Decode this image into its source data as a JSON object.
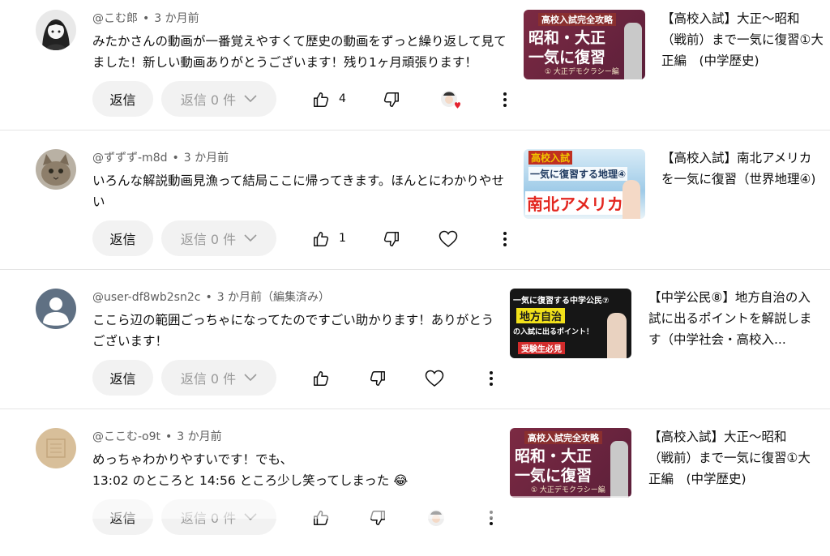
{
  "comments": [
    {
      "author": "@こむ郎",
      "time": "3 か月前",
      "text": "みたかさんの動画が一番覚えやすくて歴史の動画をずっと繰り返して見てました！新しい動画ありがとうございます！残り1ヶ月頑張ります！",
      "reply_label": "返信",
      "replies_label": "返信 0 件",
      "likes": "4",
      "video_title": "【高校入試】大正〜昭和（戦前）まで一気に復習①大正編　(中学歴史)",
      "thumb": {
        "top": "高校入試完全攻略",
        "main1": "昭和・大正",
        "main2": "一気に復習",
        "sub": "① 大正デモクラシー編"
      }
    },
    {
      "author": "@ずずず-m8d",
      "time": "3 か月前",
      "text": "いろんな解説動画見漁って結局ここに帰ってきます。ほんとにわかりやせい",
      "reply_label": "返信",
      "replies_label": "返信 0 件",
      "likes": "1",
      "video_title": "【高校入試】南北アメリカを一気に復習（世界地理④)",
      "thumb": {
        "top": "高校入試",
        "main1": "一気に復習する地理④",
        "main2": "南北アメリカ"
      }
    },
    {
      "author": "@user-df8wb2sn2c",
      "time": "3 か月前（編集済み）",
      "text": "ここら辺の範囲ごっちゃになってたのですごい助かります！ありがとうございます！",
      "reply_label": "返信",
      "replies_label": "返信 0 件",
      "likes": "",
      "video_title": "【中学公民⑧】地方自治の入試に出るポイントを解説します（中学社会・高校入...",
      "thumb": {
        "top": "一気に復習する中学公民⑦",
        "main1": "地方自治",
        "main2": "の入試に出るポイント！",
        "sub": "受験生必見"
      }
    },
    {
      "author": "@ここむ-o9t",
      "time": "3 か月前",
      "text_line1": "めっちゃわかりやすいです！でも、",
      "text_line2": "13:02 のところと 14:56 ところ少し笑ってしまった 😂",
      "reply_label": "返信",
      "replies_label": "返信 0 件",
      "likes": "",
      "video_title": "【高校入試】大正〜昭和（戦前）まで一気に復習①大正編　(中学歴史)",
      "thumb": {
        "top": "高校入試完全攻略",
        "main1": "昭和・大正",
        "main2": "一気に復習",
        "sub": "① 大正デモクラシー編"
      }
    }
  ]
}
